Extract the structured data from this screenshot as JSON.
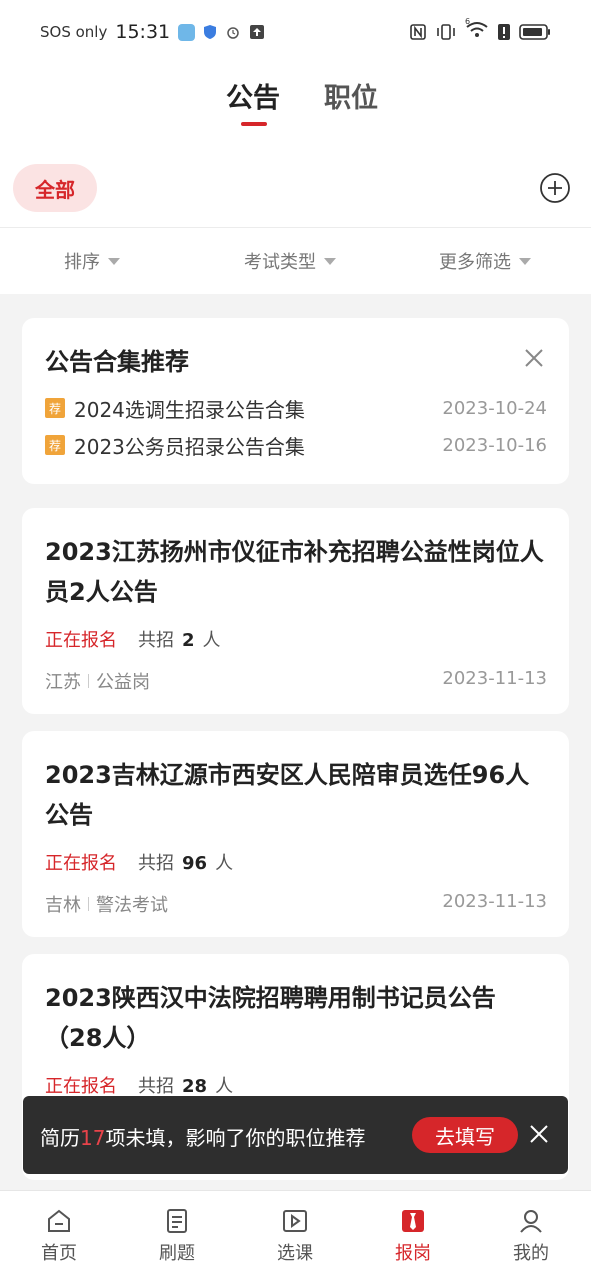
{
  "status_bar": {
    "sos": "SOS only",
    "time": "15:31",
    "network_badge": "6"
  },
  "header": {
    "tabs": [
      {
        "label": "公告",
        "active": true
      },
      {
        "label": "职位",
        "active": false
      }
    ]
  },
  "chip": {
    "label": "全部"
  },
  "filters": [
    {
      "label": "排序"
    },
    {
      "label": "考试类型"
    },
    {
      "label": "更多筛选"
    }
  ],
  "recommend": {
    "title": "公告合集推荐",
    "items": [
      {
        "tag": "荐",
        "text": "2024选调生招录公告合集",
        "date": "2023-10-24"
      },
      {
        "tag": "荐",
        "text": "2023公务员招录公告合集",
        "date": "2023-10-16"
      }
    ]
  },
  "announcements": [
    {
      "title": "2023江苏扬州市仪征市补充招聘公益性岗位人员2人公告",
      "status": "正在报名",
      "count_prefix": "共招",
      "count": "2",
      "count_unit": "人",
      "region": "江苏",
      "category": "公益岗",
      "date": "2023-11-13"
    },
    {
      "title": "2023吉林辽源市西安区人民陪审员选任96人公告",
      "status": "正在报名",
      "count_prefix": "共招",
      "count": "96",
      "count_unit": "人",
      "region": "吉林",
      "category": "警法考试",
      "date": "2023-11-13"
    },
    {
      "title": "2023陕西汉中法院招聘聘用制书记员公告（28人）",
      "status": "正在报名",
      "count_prefix": "共招",
      "count": "28",
      "count_unit": "人"
    }
  ],
  "toast": {
    "text_before": "简历",
    "number": "17",
    "text_after": "项未填，影响了你的职位推荐",
    "button": "去填写"
  },
  "bottom_nav": [
    {
      "label": "首页",
      "icon": "home-icon",
      "active": false
    },
    {
      "label": "刷题",
      "icon": "practice-icon",
      "active": false
    },
    {
      "label": "选课",
      "icon": "course-icon",
      "active": false
    },
    {
      "label": "报岗",
      "icon": "job-tie-icon",
      "active": true
    },
    {
      "label": "我的",
      "icon": "profile-icon",
      "active": false
    }
  ],
  "colors": {
    "accent": "#d6262a",
    "tag_orange": "#f0a43a",
    "background": "#f3f3f3"
  }
}
